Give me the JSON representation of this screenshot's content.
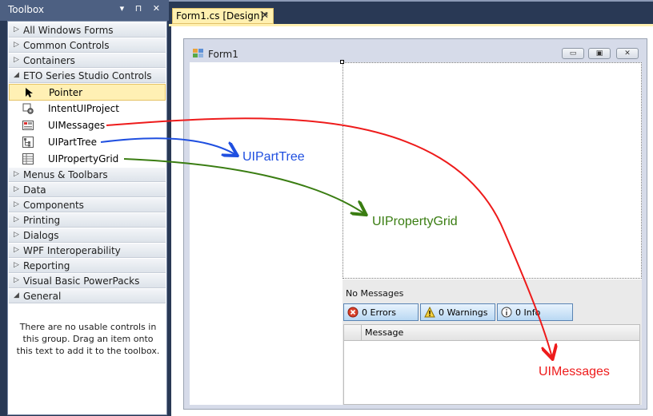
{
  "toolbox": {
    "title": "Toolbox",
    "header_buttons": "▾ ⊓ ✕",
    "categories_top": [
      {
        "label": "All Windows Forms",
        "state": "collapsed"
      },
      {
        "label": "Common Controls",
        "state": "collapsed"
      },
      {
        "label": "Containers",
        "state": "collapsed"
      },
      {
        "label": "ETO Series Studio Controls",
        "state": "expanded"
      }
    ],
    "items": [
      {
        "label": "Pointer",
        "icon": "pointer-icon",
        "selected": true
      },
      {
        "label": "IntentUIProject",
        "icon": "component-gear-icon"
      },
      {
        "label": "UIMessages",
        "icon": "messages-control-icon"
      },
      {
        "label": "UIPartTree",
        "icon": "tree-control-icon"
      },
      {
        "label": "UIPropertyGrid",
        "icon": "property-grid-icon"
      }
    ],
    "categories_bottom": [
      {
        "label": "Menus & Toolbars",
        "state": "collapsed"
      },
      {
        "label": "Data",
        "state": "collapsed"
      },
      {
        "label": "Components",
        "state": "collapsed"
      },
      {
        "label": "Printing",
        "state": "collapsed"
      },
      {
        "label": "Dialogs",
        "state": "collapsed"
      },
      {
        "label": "WPF Interoperability",
        "state": "collapsed"
      },
      {
        "label": "Reporting",
        "state": "collapsed"
      },
      {
        "label": "Visual Basic PowerPacks",
        "state": "collapsed"
      },
      {
        "label": "General",
        "state": "expanded"
      }
    ],
    "empty_message": "There are no usable controls in this group. Drag an item onto this text to add it to the toolbox."
  },
  "tab": {
    "label": "Form1.cs [Design]*",
    "close": "✕"
  },
  "form": {
    "title": "Form1",
    "window_buttons": [
      "▭",
      "▣",
      "✕"
    ],
    "messages": {
      "status": "No Messages",
      "buttons": [
        {
          "label": "0 Errors",
          "icon": "error-icon"
        },
        {
          "label": "0 Warnings",
          "icon": "warning-icon"
        },
        {
          "label": "0 Info",
          "icon": "info-icon"
        }
      ],
      "column": "Message"
    }
  },
  "annotations": {
    "part_tree": "UIPartTree",
    "property_grid": "UIPropertyGrid",
    "messages": "UIMessages"
  },
  "colors": {
    "blue_arrow": "#1f4fe0",
    "green_arrow": "#3a7d12",
    "red_arrow": "#ee1b1b",
    "ide_bg": "#293955",
    "selected": "#fff0b4"
  }
}
